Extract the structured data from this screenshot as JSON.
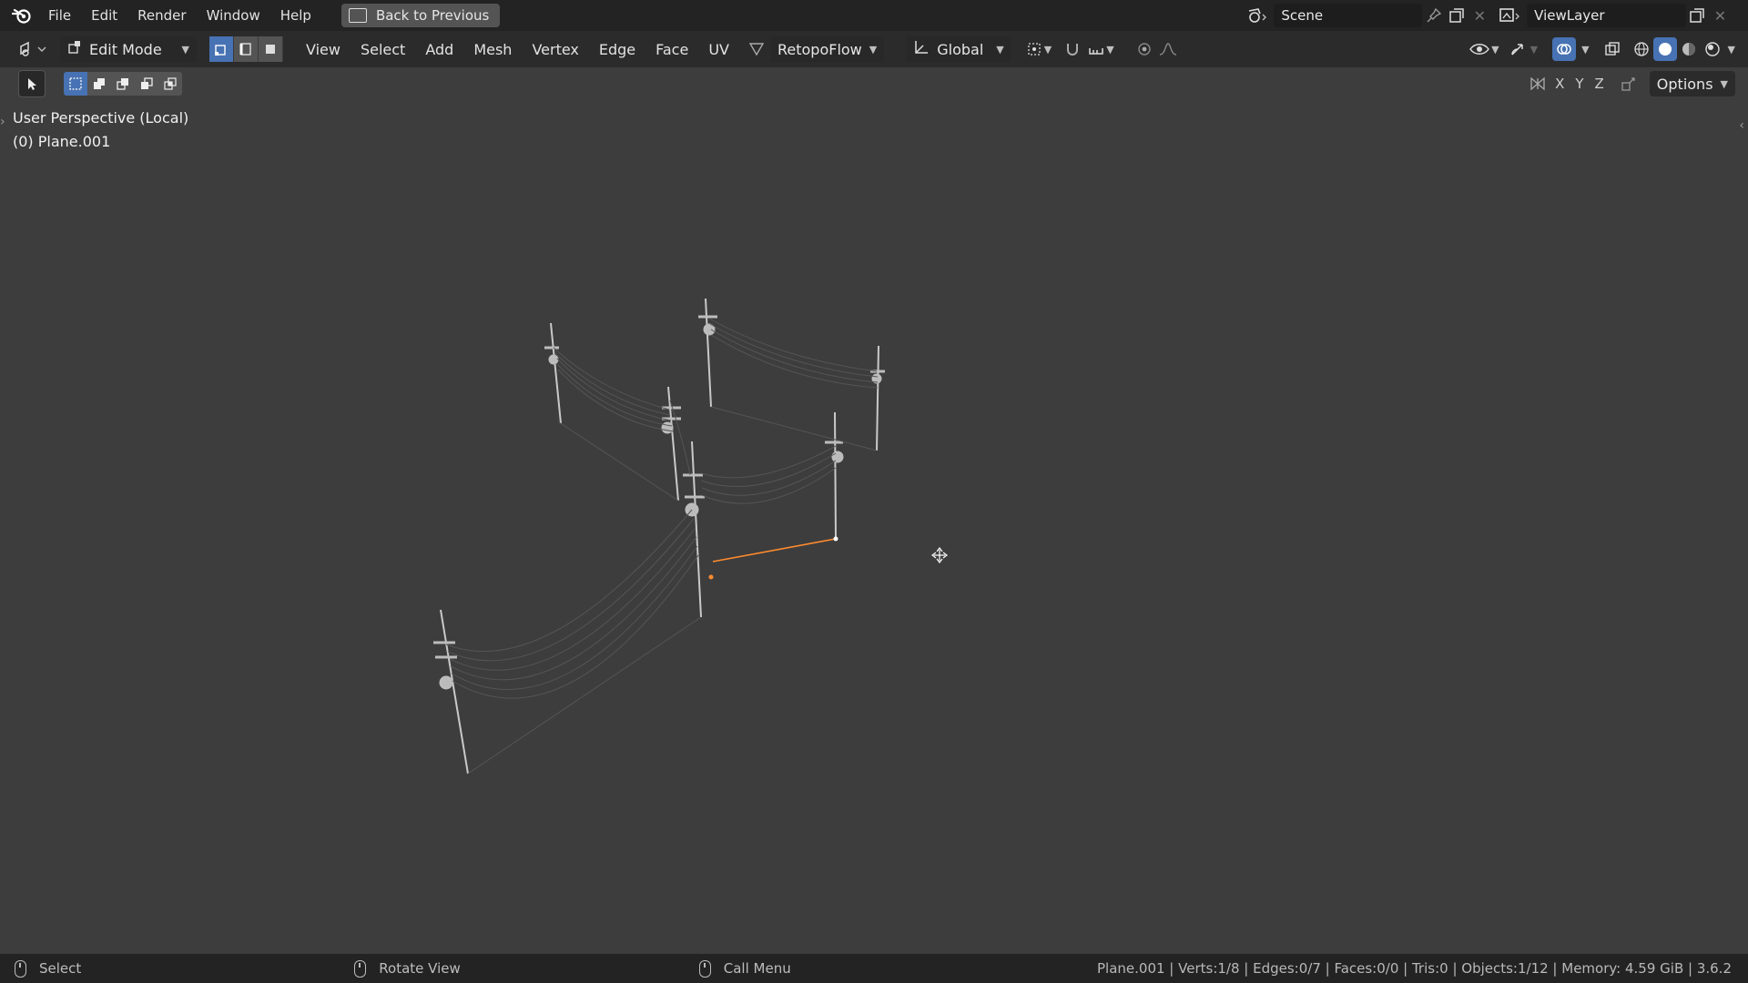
{
  "topbar": {
    "menus": [
      "File",
      "Edit",
      "Render",
      "Window",
      "Help"
    ],
    "back_button": "Back to Previous",
    "scene": "Scene",
    "view_layer": "ViewLayer"
  },
  "header": {
    "mode": "Edit Mode",
    "menus": [
      "View",
      "Select",
      "Add",
      "Mesh",
      "Vertex",
      "Edge",
      "Face",
      "UV"
    ],
    "addon": "RetopoFlow",
    "transform_orientation": "Global"
  },
  "toolbar": {
    "axes": [
      "X",
      "Y",
      "Z"
    ],
    "options": "Options"
  },
  "viewport": {
    "view_name": "User Perspective (Local)",
    "object_name": "(0) Plane.001"
  },
  "status": {
    "left_action": "Select",
    "middle_action": "Rotate View",
    "right_action": "Call Menu",
    "stats": "Plane.001 | Verts:1/8 | Edges:0/7 | Faces:0/0 | Tris:0 | Objects:1/12 | Memory: 4.59 GiB | 3.6.2"
  },
  "colors": {
    "accent": "#4772b3",
    "selection": "#ff8c2e"
  }
}
